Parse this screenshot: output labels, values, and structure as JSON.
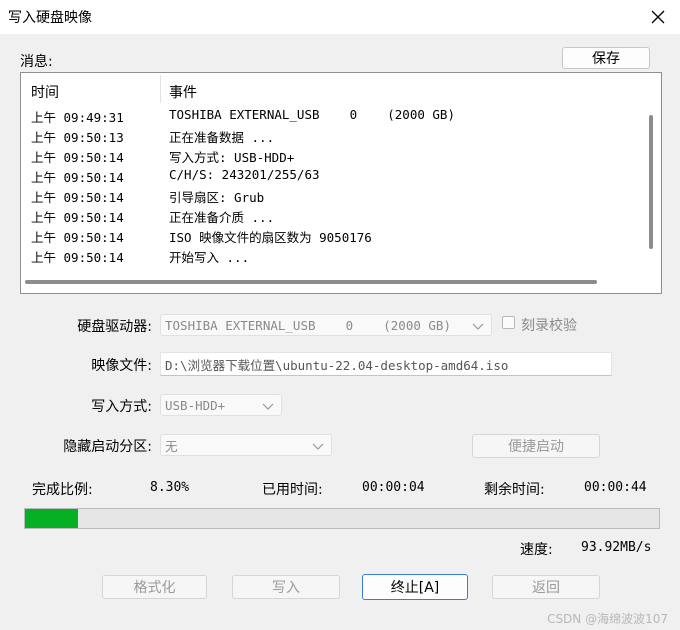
{
  "window": {
    "title": "写入硬盘映像"
  },
  "messages": {
    "label": "消息:",
    "save_label": "保存",
    "columns": {
      "time": "时间",
      "event": "事件"
    },
    "rows": [
      {
        "time": "上午 09:49:31",
        "event": "TOSHIBA EXTERNAL_USB    0    (2000 GB)"
      },
      {
        "time": "上午 09:50:13",
        "event": "正在准备数据 ..."
      },
      {
        "time": "上午 09:50:14",
        "event": "写入方式: USB-HDD+"
      },
      {
        "time": "上午 09:50:14",
        "event": "C/H/S: 243201/255/63"
      },
      {
        "time": "上午 09:50:14",
        "event": "引导扇区: Grub"
      },
      {
        "time": "上午 09:50:14",
        "event": "正在准备介质 ..."
      },
      {
        "time": "上午 09:50:14",
        "event": "ISO 映像文件的扇区数为 9050176"
      },
      {
        "time": "上午 09:50:14",
        "event": "开始写入 ..."
      }
    ]
  },
  "form": {
    "drive_label": "硬盘驱动器:",
    "drive_value": "TOSHIBA EXTERNAL_USB    0    (2000 GB)",
    "verify_label": "刻录校验",
    "verify_checked": false,
    "image_label": "映像文件:",
    "image_value": "D:\\浏览器下载位置\\ubuntu-22.04-desktop-amd64.iso",
    "method_label": "写入方式:",
    "method_value": "USB-HDD+",
    "hidden_label": "隐藏启动分区:",
    "hidden_value": "无",
    "portable_label": "便捷启动"
  },
  "stats": {
    "progress_label": "完成比例:",
    "progress_value": "8.30%",
    "progress_fraction": 0.083,
    "elapsed_label": "已用时间:",
    "elapsed_value": "00:00:04",
    "remaining_label": "剩余时间:",
    "remaining_value": "00:00:44",
    "speed_label": "速度:",
    "speed_value": "93.92MB/s"
  },
  "buttons": {
    "format": "格式化",
    "write": "写入",
    "stop": "终止[A]",
    "back": "返回"
  },
  "watermark": "CSDN @海绵波波107",
  "colors": {
    "progress": "#06b025"
  }
}
